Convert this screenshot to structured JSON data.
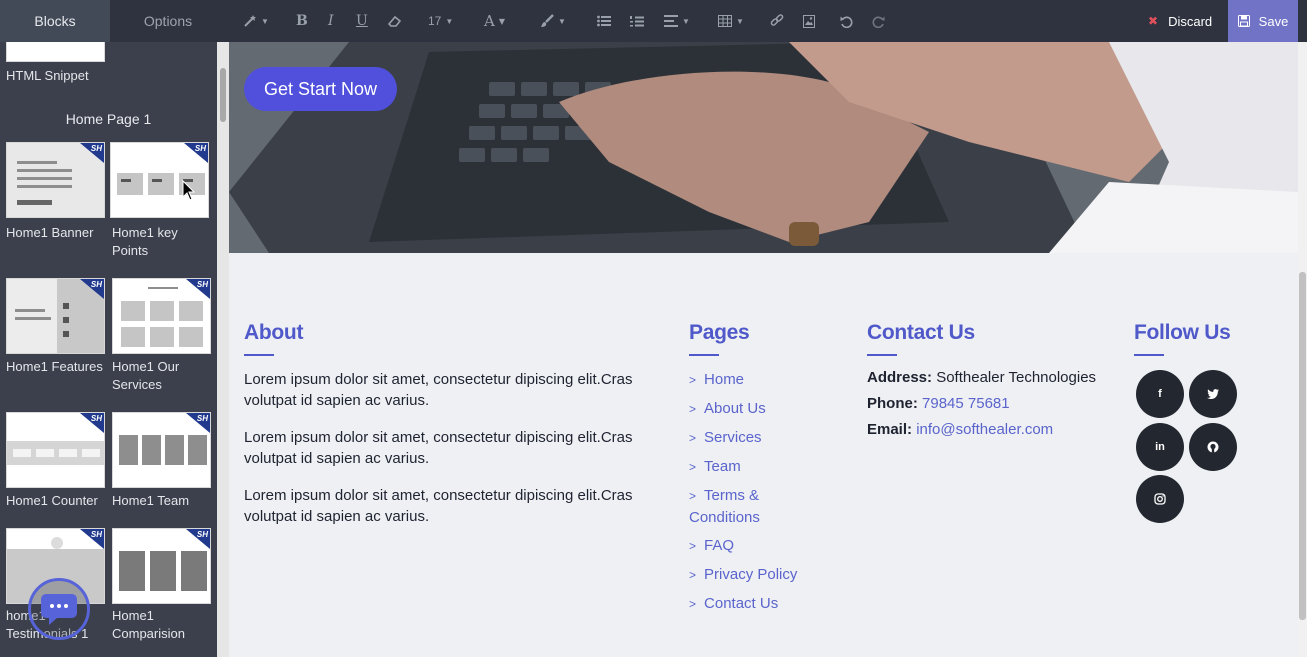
{
  "toolbar": {
    "tabs": [
      {
        "label": "Blocks"
      },
      {
        "label": "Options"
      }
    ],
    "font_size": "17",
    "discard_label": "Discard",
    "save_label": "Save"
  },
  "sidebar": {
    "top_label": "HTML Snippet",
    "section_title": "Home Page 1",
    "blocks": [
      {
        "label": "Home1 Banner"
      },
      {
        "label": "Home1 key Points"
      },
      {
        "label": "Home1 Features"
      },
      {
        "label": "Home1 Our Services"
      },
      {
        "label": "Home1 Counter"
      },
      {
        "label": "Home1 Team"
      },
      {
        "label": "home1 Testimonials 1"
      },
      {
        "label": "Home1 Comparision"
      }
    ],
    "badge": "SH"
  },
  "hero": {
    "cta_label": "Get Start Now"
  },
  "footer": {
    "about": {
      "title": "About",
      "paragraphs": [
        "Lorem ipsum dolor sit amet, consectetur dipiscing elit.Cras volutpat id sapien ac varius.",
        "Lorem ipsum dolor sit amet, consectetur dipiscing elit.Cras volutpat id sapien ac varius.",
        "Lorem ipsum dolor sit amet, consectetur dipiscing elit.Cras volutpat id sapien ac varius."
      ]
    },
    "pages": {
      "title": "Pages",
      "links": [
        "Home",
        "About Us",
        "Services",
        "Team",
        "Terms & Conditions",
        "FAQ",
        "Privacy Policy",
        "Contact Us"
      ]
    },
    "contact": {
      "title": "Contact Us",
      "address_label": "Address:",
      "address": "Softhealer Technologies",
      "phone_label": "Phone:",
      "phone": "79845 75681",
      "email_label": "Email:",
      "email": "info@softhealer.com"
    },
    "follow": {
      "title": "Follow Us",
      "networks": [
        "f",
        "t",
        "in",
        "gh",
        "ig"
      ]
    }
  },
  "colors": {
    "accent": "#5059c9",
    "button": "#5050dc",
    "sidebar_bg": "#3b404c",
    "toolbar_bg": "#2e333f",
    "discard_icon": "#e0505a",
    "save_bg": "#7173c7"
  }
}
